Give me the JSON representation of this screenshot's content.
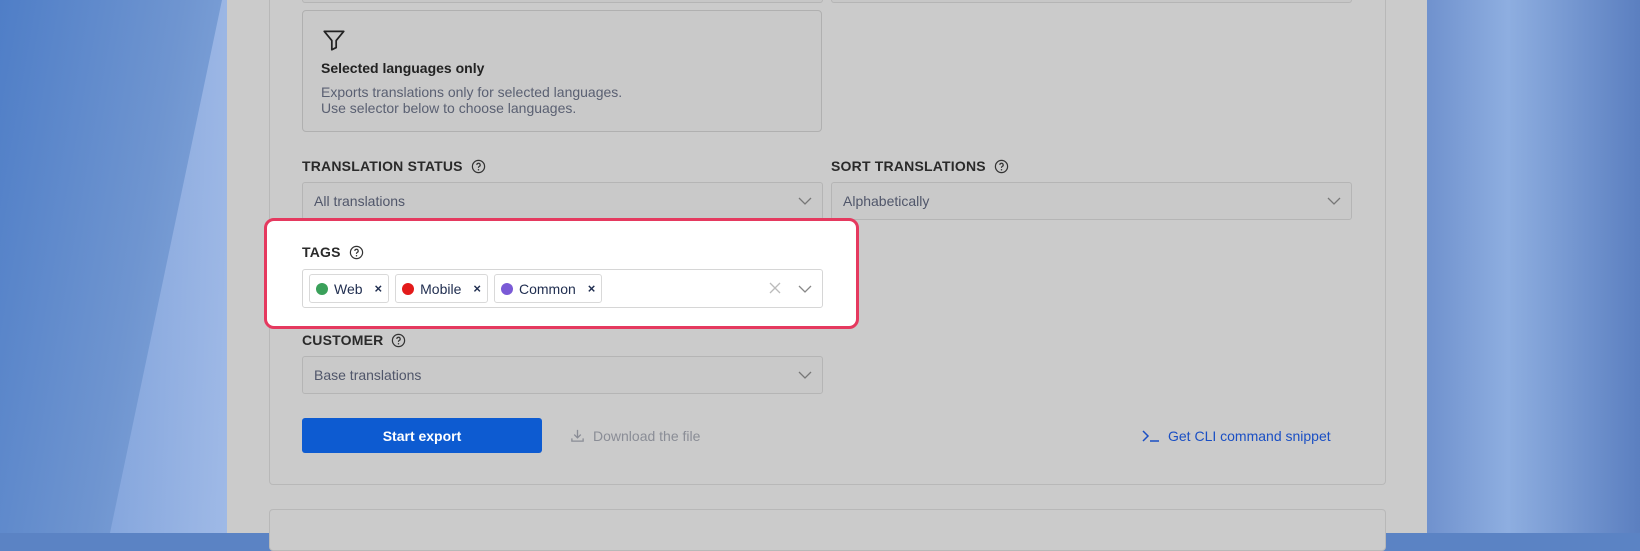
{
  "language_option": {
    "title": "Selected languages only",
    "description_line1": "Exports translations only for selected languages.",
    "description_line2": "Use selector below to choose languages."
  },
  "translation_status": {
    "label": "TRANSLATION STATUS",
    "value": "All translations"
  },
  "sort_translations": {
    "label": "SORT TRANSLATIONS",
    "value": "Alphabetically"
  },
  "tags": {
    "label": "TAGS",
    "chips": [
      {
        "name": "Web",
        "color": "#3aa05a"
      },
      {
        "name": "Mobile",
        "color": "#e31a1a"
      },
      {
        "name": "Common",
        "color": "#7a5ad6"
      }
    ],
    "remove_glyph": "×"
  },
  "customer": {
    "label": "CUSTOMER",
    "value": "Base translations"
  },
  "actions": {
    "start_export": "Start export",
    "download": "Download the file",
    "cli_snippet": "Get CLI command snippet"
  },
  "colors": {
    "accent": "#0d5bd1",
    "highlight_border": "#e5395f"
  }
}
